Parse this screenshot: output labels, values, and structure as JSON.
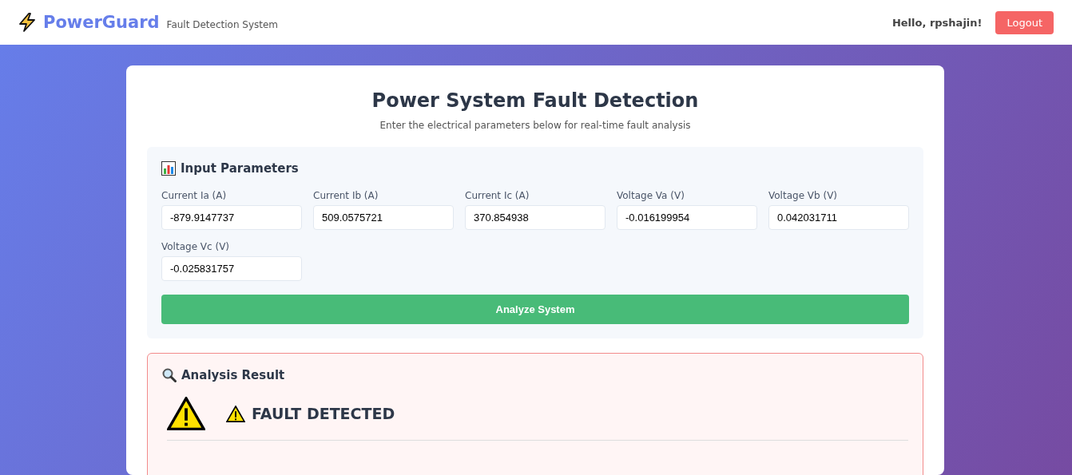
{
  "header": {
    "brand": "PowerGuard",
    "tagline": "Fault Detection System",
    "greeting": "Hello, rpshajin!",
    "logout": "Logout"
  },
  "page": {
    "title": "Power System Fault Detection",
    "subtitle": "Enter the electrical parameters below for real-time fault analysis"
  },
  "inputs": {
    "title": "Input Parameters",
    "fields": [
      {
        "label": "Current Ia (A)",
        "value": "-879.9147737"
      },
      {
        "label": "Current Ib (A)",
        "value": "509.0575721"
      },
      {
        "label": "Current Ic (A)",
        "value": "370.854938"
      },
      {
        "label": "Voltage Va (V)",
        "value": "-0.016199954"
      },
      {
        "label": "Voltage Vb (V)",
        "value": "0.042031711"
      },
      {
        "label": "Voltage Vc (V)",
        "value": "-0.025831757"
      }
    ],
    "button": "Analyze System"
  },
  "result": {
    "title": "Analysis Result",
    "status": "FAULT DETECTED",
    "fault": true
  }
}
